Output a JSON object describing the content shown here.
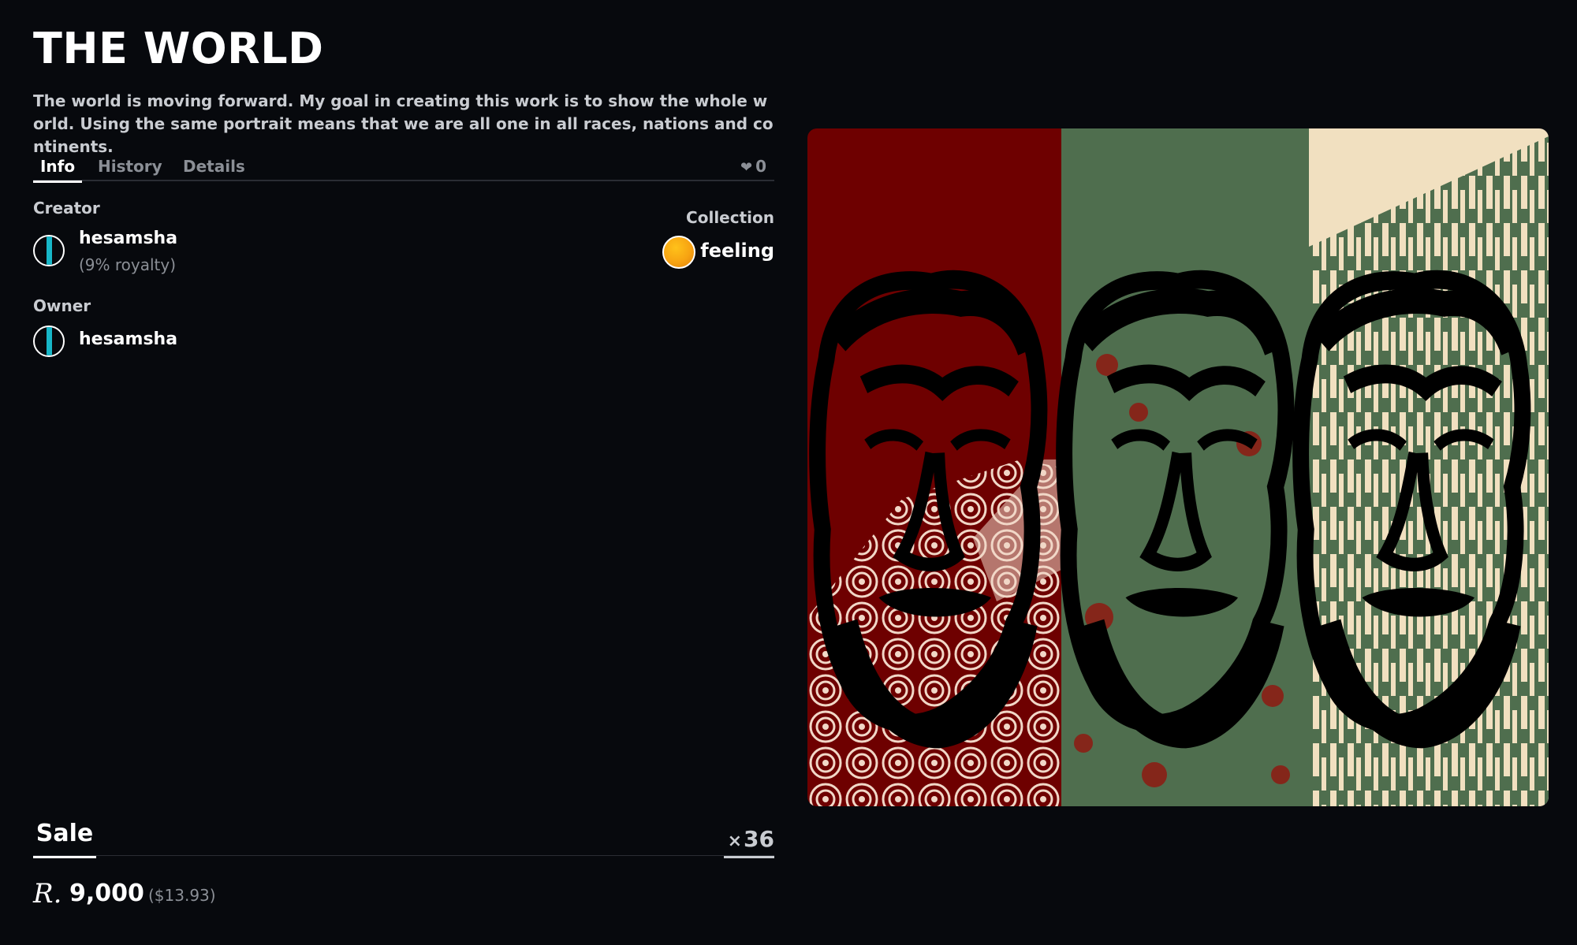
{
  "title": "THE WORLD",
  "description": "The world is moving forward. My goal in creating this work is to show the whole world. Using the same portrait means that we are all one in all races, nations and continents.",
  "tabs": [
    {
      "label": "Info",
      "active": true
    },
    {
      "label": "History",
      "active": false
    },
    {
      "label": "Details",
      "active": false
    }
  ],
  "likes": {
    "icon": "heart-icon",
    "count": "0"
  },
  "creator": {
    "label": "Creator",
    "name": "hesamsha",
    "royalty": "(9% royalty)"
  },
  "owner": {
    "label": "Owner",
    "name": "hesamsha"
  },
  "collection": {
    "label": "Collection",
    "name": "feeling"
  },
  "sale": {
    "label": "Sale",
    "quantity": "36",
    "currency_icon": "rial-icon",
    "price": "9,000",
    "usd": "($13.93)"
  },
  "colors": {
    "accent_teal": "#17b7c8",
    "collection_orange": "#f7a312",
    "panel_red": "#6e0000",
    "panel_green": "#4f6e4e",
    "panel_cream": "#f1e0c0"
  }
}
